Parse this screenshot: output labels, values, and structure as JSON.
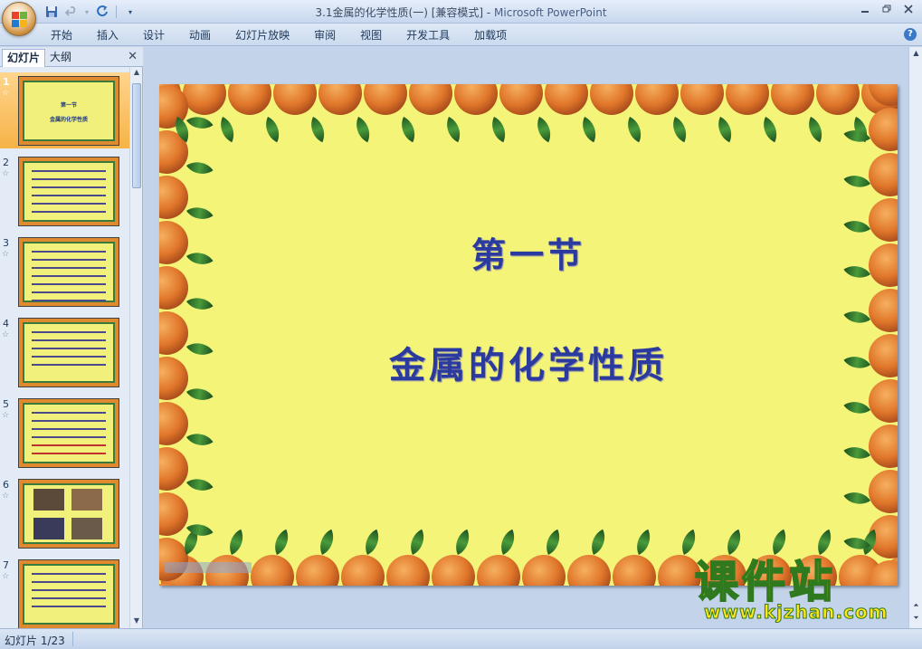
{
  "window": {
    "title": "3.1金属的化学性质(一) [兼容模式]",
    "app_name": "Microsoft PowerPoint",
    "title_separator": " - "
  },
  "ribbon": {
    "tabs": [
      "开始",
      "插入",
      "设计",
      "动画",
      "幻灯片放映",
      "审阅",
      "视图",
      "开发工具",
      "加载项"
    ]
  },
  "left_pane": {
    "tab_slides": "幻灯片",
    "tab_outline": "大纲",
    "close_glyph": "✕",
    "thumbnails": [
      {
        "number": "1",
        "title": "第一节",
        "subtitle": "金属的化学性质"
      },
      {
        "number": "2"
      },
      {
        "number": "3"
      },
      {
        "number": "4"
      },
      {
        "number": "5"
      },
      {
        "number": "6"
      },
      {
        "number": "7"
      }
    ]
  },
  "slide": {
    "title": "第一节",
    "subtitle": "金属的化学性质"
  },
  "status": {
    "slide_indicator": "幻灯片 1/23"
  },
  "watermark": {
    "main": "课件站",
    "url": "www.kjzhan.com"
  },
  "colors": {
    "slide_bg": "#f4f478",
    "title_text": "#2b3a9e",
    "selected_thumb": "#f6b347"
  }
}
